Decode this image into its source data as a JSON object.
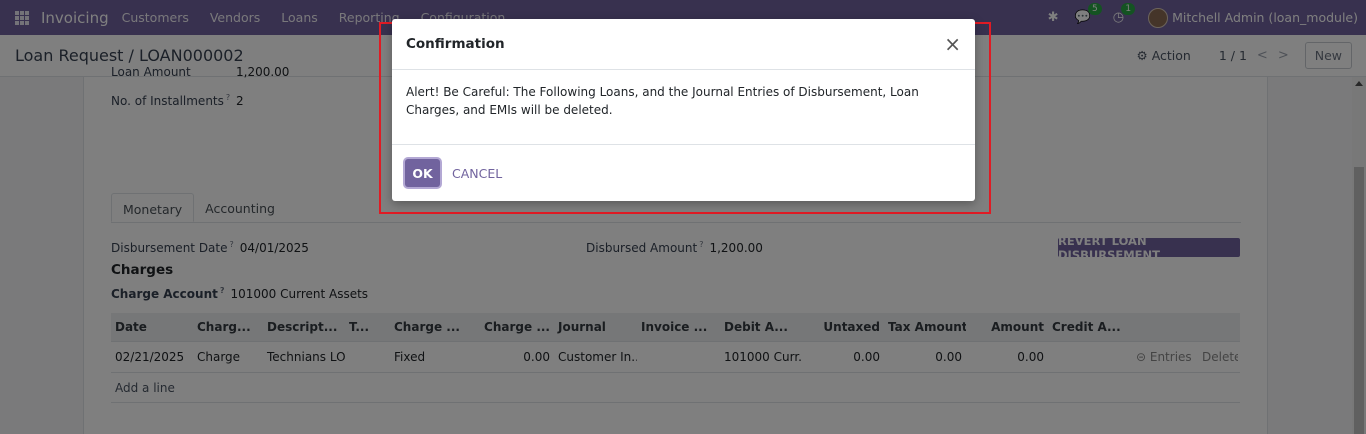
{
  "navbar": {
    "app_name": "Invoicing",
    "menu": [
      "Customers",
      "Vendors",
      "Loans",
      "Reporting",
      "Configuration"
    ],
    "chat_badge": "5",
    "activity_badge": "1",
    "user": "Mitchell Admin (loan_module)"
  },
  "control": {
    "breadcrumb": "Loan Request / LOAN000002",
    "action": "⚙ Action",
    "pager": "1 / 1",
    "new_label": "New"
  },
  "form": {
    "loan_amount_label": "Loan Amount",
    "loan_amount_value": "1,200.00",
    "installments_label": "No. of Installments",
    "installments_value": "2",
    "tabs": [
      "Monetary",
      "Accounting"
    ],
    "disbursement_date_label": "Disbursement Date",
    "disbursement_date_value": "04/01/2025",
    "disbursed_amount_label": "Disbursed Amount",
    "disbursed_amount_value": "1,200.00",
    "revert_label": "REVERT LOAN DISBURSEMENT",
    "charges_title": "Charges",
    "charge_account_label": "Charge Account",
    "charge_account_value": "101000 Current Assets"
  },
  "table": {
    "headers": [
      "Date",
      "Charg...",
      "Descript...",
      "T...",
      "Charge ...",
      "Charge ...",
      "Journal",
      "Invoice ...",
      "Debit A...",
      "Untaxed",
      "Tax Amount",
      "Amount",
      "Credit A...",
      "",
      ""
    ],
    "rows": [
      [
        "02/21/2025",
        "Charge",
        "Technians LO...",
        "",
        "Fixed",
        "0.00",
        "Customer In...",
        "",
        "101000 Curr...",
        "0.00",
        "0.00",
        "0.00",
        "",
        "⊝ Entries",
        "Delete"
      ]
    ],
    "add_line": "Add a line"
  },
  "modal": {
    "title": "Confirmation",
    "close": "×",
    "body": "Alert! Be Careful: The Following Loans, and the Journal Entries of Disbursement, Loan Charges, and EMIs will be deleted.",
    "ok_label": "OK",
    "cancel_label": "CANCEL"
  },
  "colors": {
    "brand": "#71639e",
    "highlight": "#e01b24",
    "badge": "#28a745"
  }
}
